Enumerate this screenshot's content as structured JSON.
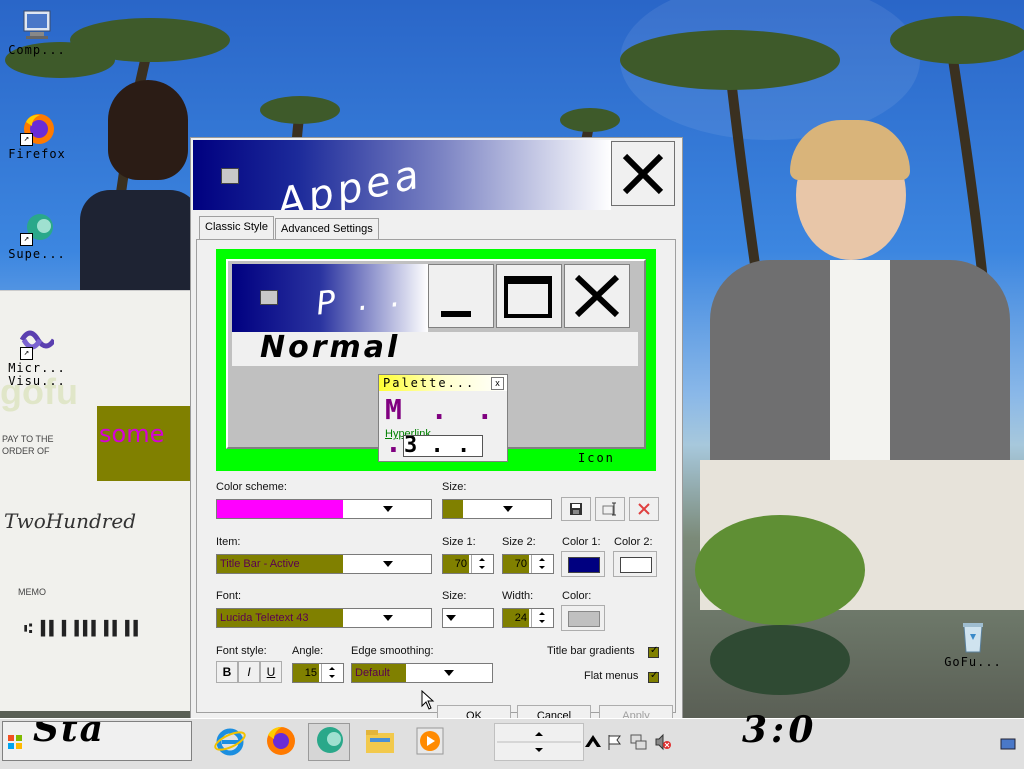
{
  "desktop": {
    "icons": [
      {
        "label": "Comp...",
        "icon": "computer-icon"
      },
      {
        "label": "Firefox",
        "icon": "firefox-icon"
      },
      {
        "label": "Supe...",
        "icon": "superchat-icon"
      },
      {
        "label": "Micr... Visu...",
        "icon": "visual-studio-icon"
      },
      {
        "label": "GoFu...",
        "icon": "recycle-bin-icon"
      }
    ],
    "wallpaper_text": "some"
  },
  "window": {
    "title": "Appea",
    "tabs": [
      {
        "label": "Classic Style",
        "active": true
      },
      {
        "label": "Advanced Settings",
        "active": false
      }
    ],
    "preview": {
      "title_text": "P . .",
      "normal_text": "Normal",
      "palette_title": "Palette...",
      "palette_close": "x",
      "palette_big": "M . . .",
      "hyperlink": "Hyperlink",
      "palette_box_text": "3 . . .",
      "icon_label": "Icon",
      "bg_color": "#00ff00"
    },
    "form": {
      "color_scheme_label": "Color scheme:",
      "color_scheme_color": "#ff00ff",
      "size_label": "Size:",
      "item_label": "Item:",
      "item_value": "Title Bar - Active",
      "size1_label": "Size 1:",
      "size1_value": "70",
      "size2_label": "Size 2:",
      "size2_value": "70",
      "color1_label": "Color 1:",
      "color1_value": "#000080",
      "color2_label": "Color 2:",
      "color2_value": "#ffffff",
      "font_label": "Font:",
      "font_value": "Lucida Teletext 43",
      "font_size_label": "Size:",
      "width_label": "Width:",
      "width_value": "24",
      "color_label": "Color:",
      "color_value": "#c0c0c0",
      "font_style_label": "Font style:",
      "bold_label": "B",
      "italic_label": "I",
      "underline_label": "U",
      "angle_label": "Angle:",
      "angle_value": "15",
      "edge_label": "Edge smoothing:",
      "edge_value": "Default",
      "gradients_label": "Title bar gradients",
      "flat_menus_label": "Flat menus",
      "olive_color": "#808000"
    },
    "buttons": {
      "ok": "OK",
      "cancel": "Cancel",
      "apply": "Apply"
    }
  },
  "taskbar": {
    "start_text": "Sta",
    "clock_text": "3:0"
  }
}
